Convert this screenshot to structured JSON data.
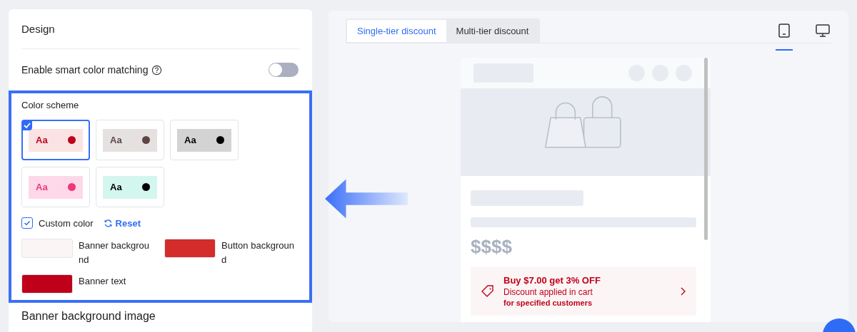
{
  "design": {
    "title": "Design",
    "smart_color": {
      "label": "Enable smart color matching",
      "on": false
    },
    "color_scheme": {
      "label": "Color scheme",
      "schemes": [
        {
          "sample": "Aa",
          "color": "#fbe3e4",
          "dot": {
            "color": "#c0001a"
          },
          "selected": true
        },
        {
          "sample": "Aa",
          "color": "#e5e1e0",
          "dot": {
            "color": "#5e4545"
          },
          "selected": false
        },
        {
          "sample": "Aa",
          "color": "#d3d3d3",
          "dot": {
            "color": "#000000"
          },
          "selected": false
        },
        {
          "sample": "Aa",
          "color": "#fdd8e8",
          "dot": {
            "color": "#f0357a"
          },
          "selected": false
        },
        {
          "sample": "Aa",
          "color": "#d3f6ef",
          "dot": {
            "color": "#000000"
          },
          "selected": false
        }
      ]
    },
    "custom_color": {
      "label": "Custom color",
      "checked": true
    },
    "reset": "Reset",
    "swatches": [
      {
        "label": "Banner background",
        "color": "#fcf5f5"
      },
      {
        "label": "Button background",
        "color": "#d42b2b"
      },
      {
        "label": "Banner text",
        "color": "#c0001a"
      }
    ],
    "next_section": "Banner background image"
  },
  "preview": {
    "tabs": [
      {
        "label": "Single-tier discount",
        "selected": true
      },
      {
        "label": "Multi-tier discount",
        "selected": false
      }
    ],
    "devices": [
      {
        "kind": "mobile",
        "selected": true
      },
      {
        "kind": "desktop",
        "selected": false
      }
    ],
    "price": "$$$$",
    "offer": {
      "title": "Buy $7.00 get 3% OFF",
      "line": "Discount applied in cart",
      "note": "for specified customers"
    }
  }
}
